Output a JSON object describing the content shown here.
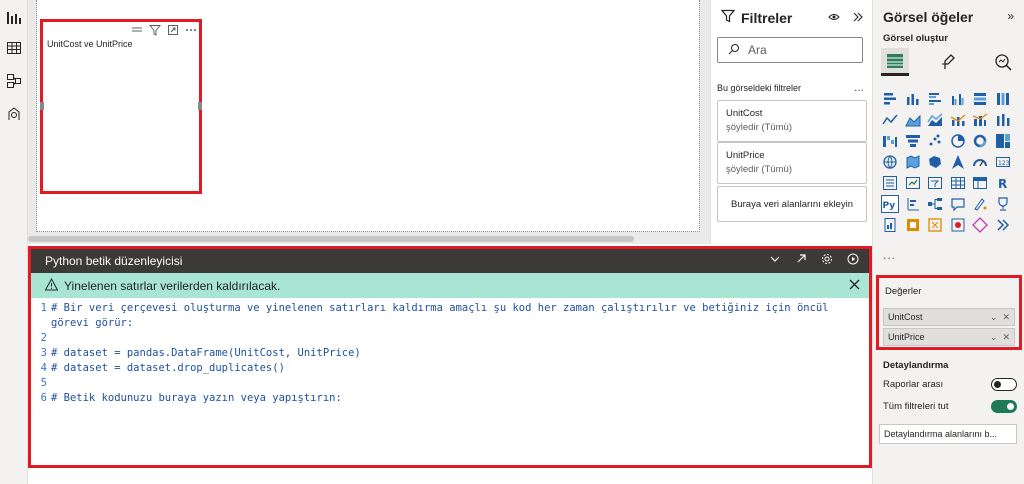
{
  "visual": {
    "title": "UnitCost ve UnitPrice"
  },
  "editor": {
    "title": "Python betik düzenleyicisi",
    "warning": "Yinelenen satırlar verilerden kaldırılacak.",
    "lines": [
      {
        "num": "1",
        "text": "# Bir veri çerçevesi oluşturma ve yinelenen satırları kaldırma amaçlı şu kod her zaman çalıştırılır ve betiğiniz için öncül"
      },
      {
        "num": "",
        "text": "görevi görür:"
      },
      {
        "num": "2",
        "text": ""
      },
      {
        "num": "3",
        "text": "# dataset = pandas.DataFrame(UnitCost, UnitPrice)"
      },
      {
        "num": "4",
        "text": "# dataset = dataset.drop_duplicates()"
      },
      {
        "num": "5",
        "text": ""
      },
      {
        "num": "6",
        "text": "# Betik kodunuzu buraya yazın veya yapıştırın:"
      }
    ]
  },
  "filters": {
    "title": "Filtreler",
    "search_placeholder": "Ara",
    "section_label": "Bu görseldeki filtreler",
    "more": "...",
    "cards": [
      {
        "name": "UnitCost",
        "state": "şöyledir (Tümü)"
      },
      {
        "name": "UnitPrice",
        "state": "şöyledir (Tümü)"
      }
    ],
    "add_label": "Buraya veri alanlarını ekleyin"
  },
  "viz": {
    "title": "Görsel öğeler",
    "collapse": "»",
    "subtitle": "Görsel oluştur",
    "ellipsis": "...",
    "values_label": "Değerler",
    "wells": [
      {
        "name": "UnitCost"
      },
      {
        "name": "UnitPrice"
      }
    ],
    "drill_title": "Detaylandırma",
    "cross_report_label": "Raporlar arası",
    "keep_filters_label": "Tüm filtreleri tut",
    "drill_field_placeholder": "Detaylandırma alanlarını b..."
  },
  "colors": {
    "highlight_red": "#e01b24",
    "warning_bg": "#a8e6d3",
    "editor_header": "#3b3a39",
    "toggle_on": "#1f7a5a",
    "code_comment": "#1e4f9c"
  }
}
